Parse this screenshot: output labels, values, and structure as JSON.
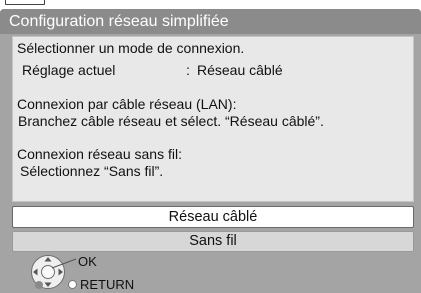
{
  "dialog": {
    "title": "Configuration réseau simplifiée",
    "info": {
      "prompt": "Sélectionner un mode de connexion.",
      "current_setting": {
        "label": "Réglage actuel",
        "separator": ":",
        "value": "Réseau câblé"
      },
      "wired": {
        "heading": "Connexion par câble réseau (LAN):",
        "instruction": "Branchez câble réseau et sélect. “Réseau câblé”."
      },
      "wireless": {
        "heading": "Connexion réseau sans fil:",
        "instruction": "Sélectionnez “Sans fil”."
      }
    },
    "options": [
      {
        "label": "Réseau câblé",
        "selected": true
      },
      {
        "label": "Sans fil",
        "selected": false
      }
    ],
    "footer": {
      "ok_label": "OK",
      "return_label": "RETURN"
    }
  },
  "icons": {
    "navigation": "remote-dpad-icon",
    "return_button": "return-button-icon",
    "color_button": "gray-dot-icon"
  },
  "colors": {
    "page": "#ffffff",
    "frame": "#a4a4a4",
    "title_bar": "#8b8b8b",
    "title_text": "#ffffff",
    "panel": "#e8e8e8",
    "panel_border": "#c4c4c4",
    "option_selected": "#ffffff",
    "option_unselected": "#d7d7d7",
    "text": "#111111"
  }
}
